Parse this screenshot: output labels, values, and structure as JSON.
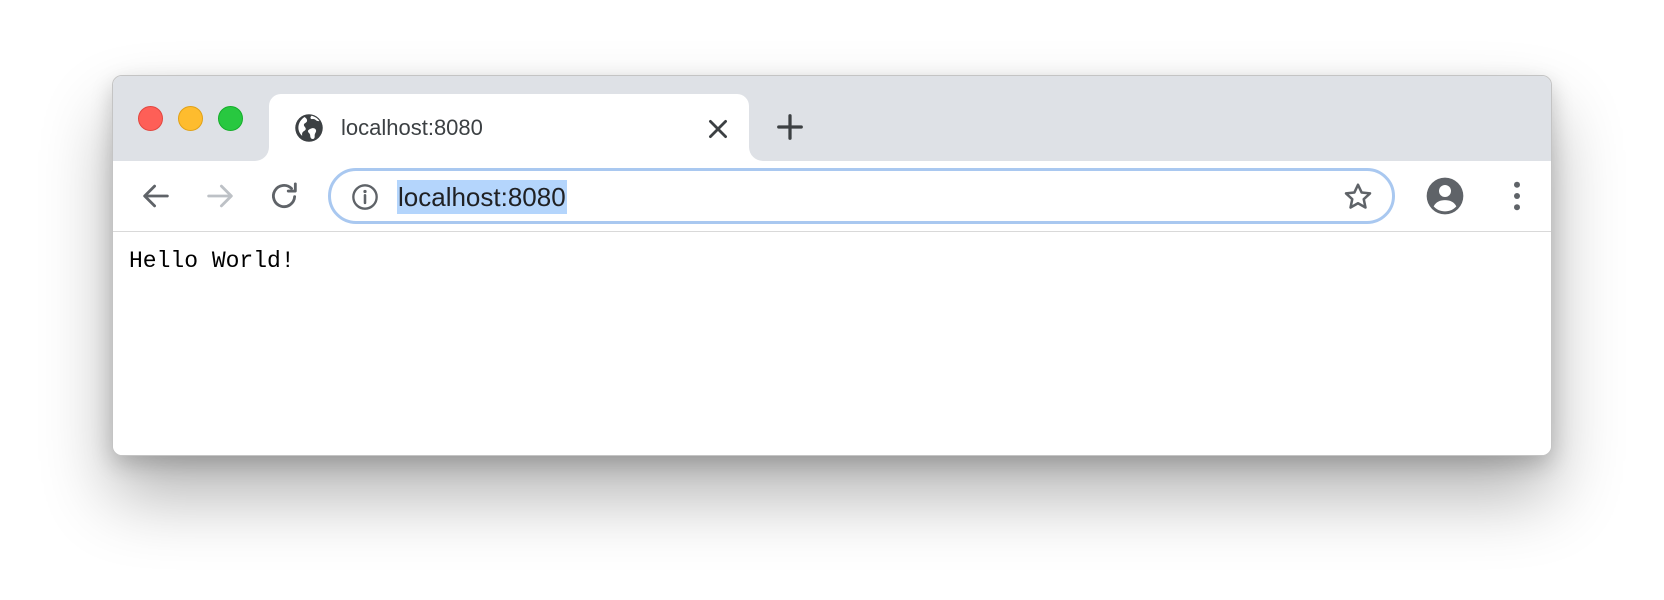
{
  "window": {
    "controls": [
      "close",
      "minimize",
      "zoom"
    ]
  },
  "tab": {
    "title": "localhost:8080",
    "favicon": "globe-icon",
    "close_icon": "close-icon"
  },
  "new_tab_icon": "plus-icon",
  "toolbar": {
    "back_icon": "arrow-left-icon",
    "forward_icon": "arrow-right-icon",
    "forward_enabled": false,
    "reload_icon": "reload-icon",
    "profile_icon": "account-circle-icon",
    "menu_icon": "more-vertical-icon"
  },
  "omnibox": {
    "url": "localhost:8080",
    "selected": true,
    "info_icon": "info-icon",
    "bookmark_icon": "star-outline-icon",
    "focus_color": "#a9c8f0",
    "selection_color": "#b4d5fc"
  },
  "page": {
    "body_text": "Hello World!"
  },
  "colors": {
    "titlebar": "#dee1e6",
    "close": "#fe5f57",
    "minimize": "#febc2e",
    "zoom": "#28c840",
    "icon": "#5f6368",
    "icon_disabled": "#bdc1c6"
  }
}
